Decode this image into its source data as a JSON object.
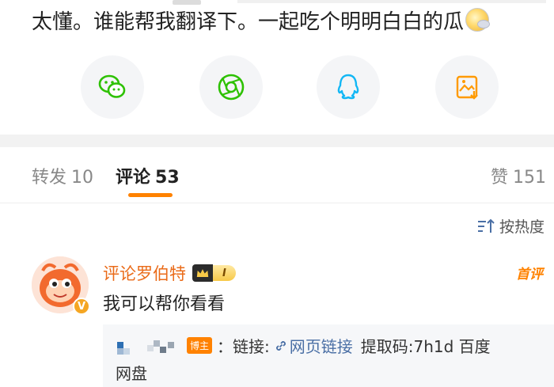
{
  "post": {
    "text": "太懂。谁能帮我翻译下。一起吃个明明白白的瓜"
  },
  "share": {
    "buttons": [
      {
        "icon": "wechat-icon",
        "color": "#2dc100"
      },
      {
        "icon": "moments-icon",
        "color": "#2dc100"
      },
      {
        "icon": "qq-icon",
        "color": "#12b7f5"
      },
      {
        "icon": "save-image-icon",
        "color": "#ff9a00"
      }
    ]
  },
  "tabs": {
    "repost_label": "转发",
    "repost_count": "10",
    "comment_label": "评论",
    "comment_count": "53",
    "like_label": "赞",
    "like_count": "151",
    "accent_color": "#ff8200"
  },
  "sort": {
    "label": "按热度"
  },
  "comment": {
    "username": "评论罗伯特",
    "rank_level": "I",
    "top_tag": "首评",
    "text": "我可以帮你看看",
    "username_color": "#ea6b19"
  },
  "reply": {
    "badge": "博主",
    "sep": "：链接:",
    "link_text": "网页链接",
    "code_text": "提取码:7h1d 百度",
    "code_text_cont": "网盘"
  }
}
